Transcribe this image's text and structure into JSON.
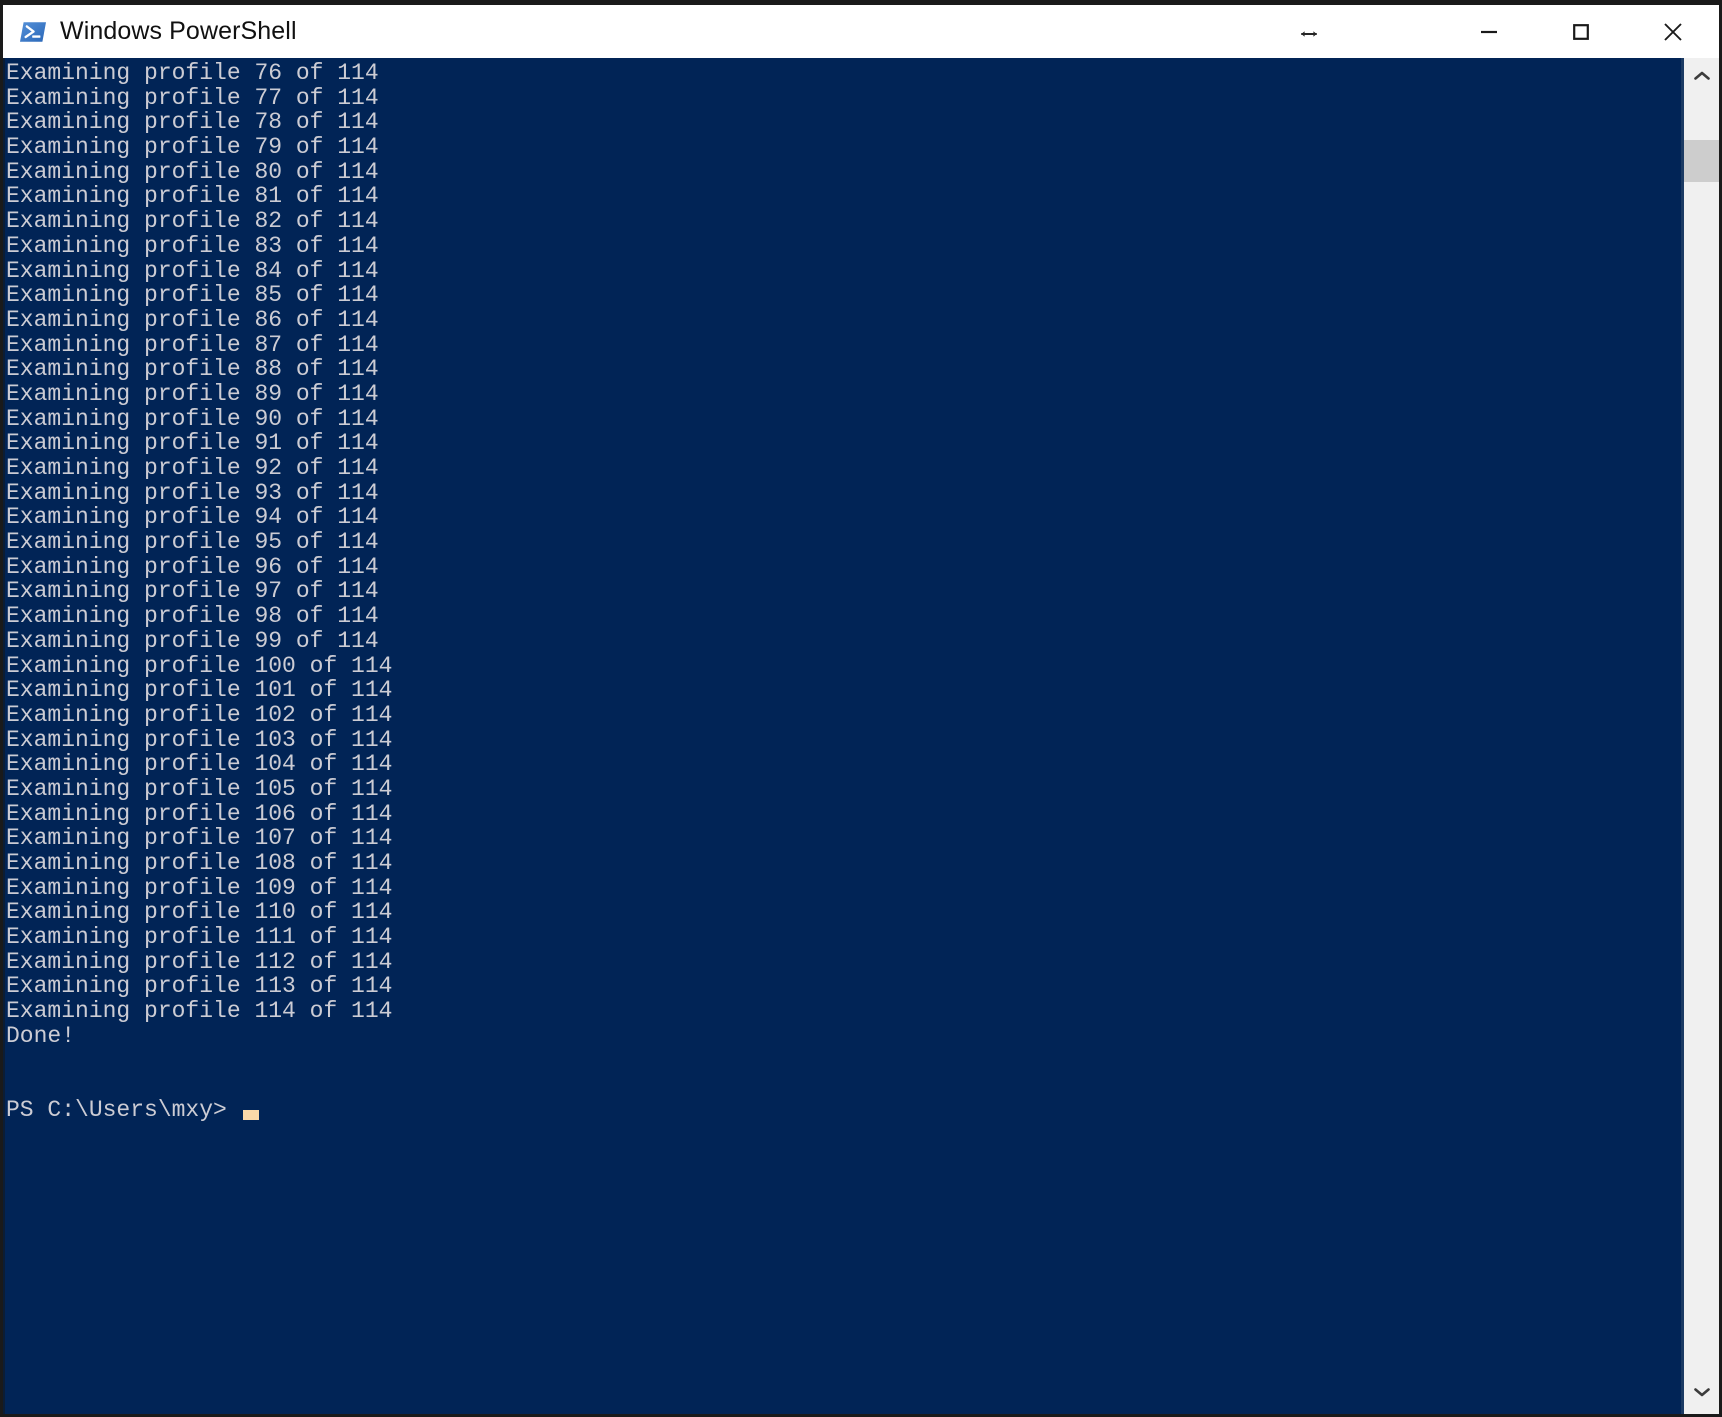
{
  "window": {
    "title": "Windows PowerShell",
    "app_icon": "powershell-icon",
    "background_color": "#012456",
    "text_color": "#ccccd4",
    "titlebar_color": "#ffffff",
    "cursor_color": "#fad9a9"
  },
  "titlebar": {
    "resize_cursor_icon": "horizontal-resize-cursor",
    "minimize_label": "Minimize",
    "maximize_label": "Maximize",
    "close_label": "Close"
  },
  "console": {
    "lines": [
      "Examining profile 76 of 114",
      "Examining profile 77 of 114",
      "Examining profile 78 of 114",
      "Examining profile 79 of 114",
      "Examining profile 80 of 114",
      "Examining profile 81 of 114",
      "Examining profile 82 of 114",
      "Examining profile 83 of 114",
      "Examining profile 84 of 114",
      "Examining profile 85 of 114",
      "Examining profile 86 of 114",
      "Examining profile 87 of 114",
      "Examining profile 88 of 114",
      "Examining profile 89 of 114",
      "Examining profile 90 of 114",
      "Examining profile 91 of 114",
      "Examining profile 92 of 114",
      "Examining profile 93 of 114",
      "Examining profile 94 of 114",
      "Examining profile 95 of 114",
      "Examining profile 96 of 114",
      "Examining profile 97 of 114",
      "Examining profile 98 of 114",
      "Examining profile 99 of 114",
      "Examining profile 100 of 114",
      "Examining profile 101 of 114",
      "Examining profile 102 of 114",
      "Examining profile 103 of 114",
      "Examining profile 104 of 114",
      "Examining profile 105 of 114",
      "Examining profile 106 of 114",
      "Examining profile 107 of 114",
      "Examining profile 108 of 114",
      "Examining profile 109 of 114",
      "Examining profile 110 of 114",
      "Examining profile 111 of 114",
      "Examining profile 112 of 114",
      "Examining profile 113 of 114",
      "Examining profile 114 of 114",
      "Done!"
    ],
    "prompt": "PS C:\\Users\\mxy>",
    "prompt_input": "",
    "total_profiles": "114",
    "status_text": "Done!"
  },
  "scrollbar": {
    "up_arrow_icon": "chevron-up-icon",
    "down_arrow_icon": "chevron-down-icon",
    "thumb_label": "scroll-thumb"
  }
}
